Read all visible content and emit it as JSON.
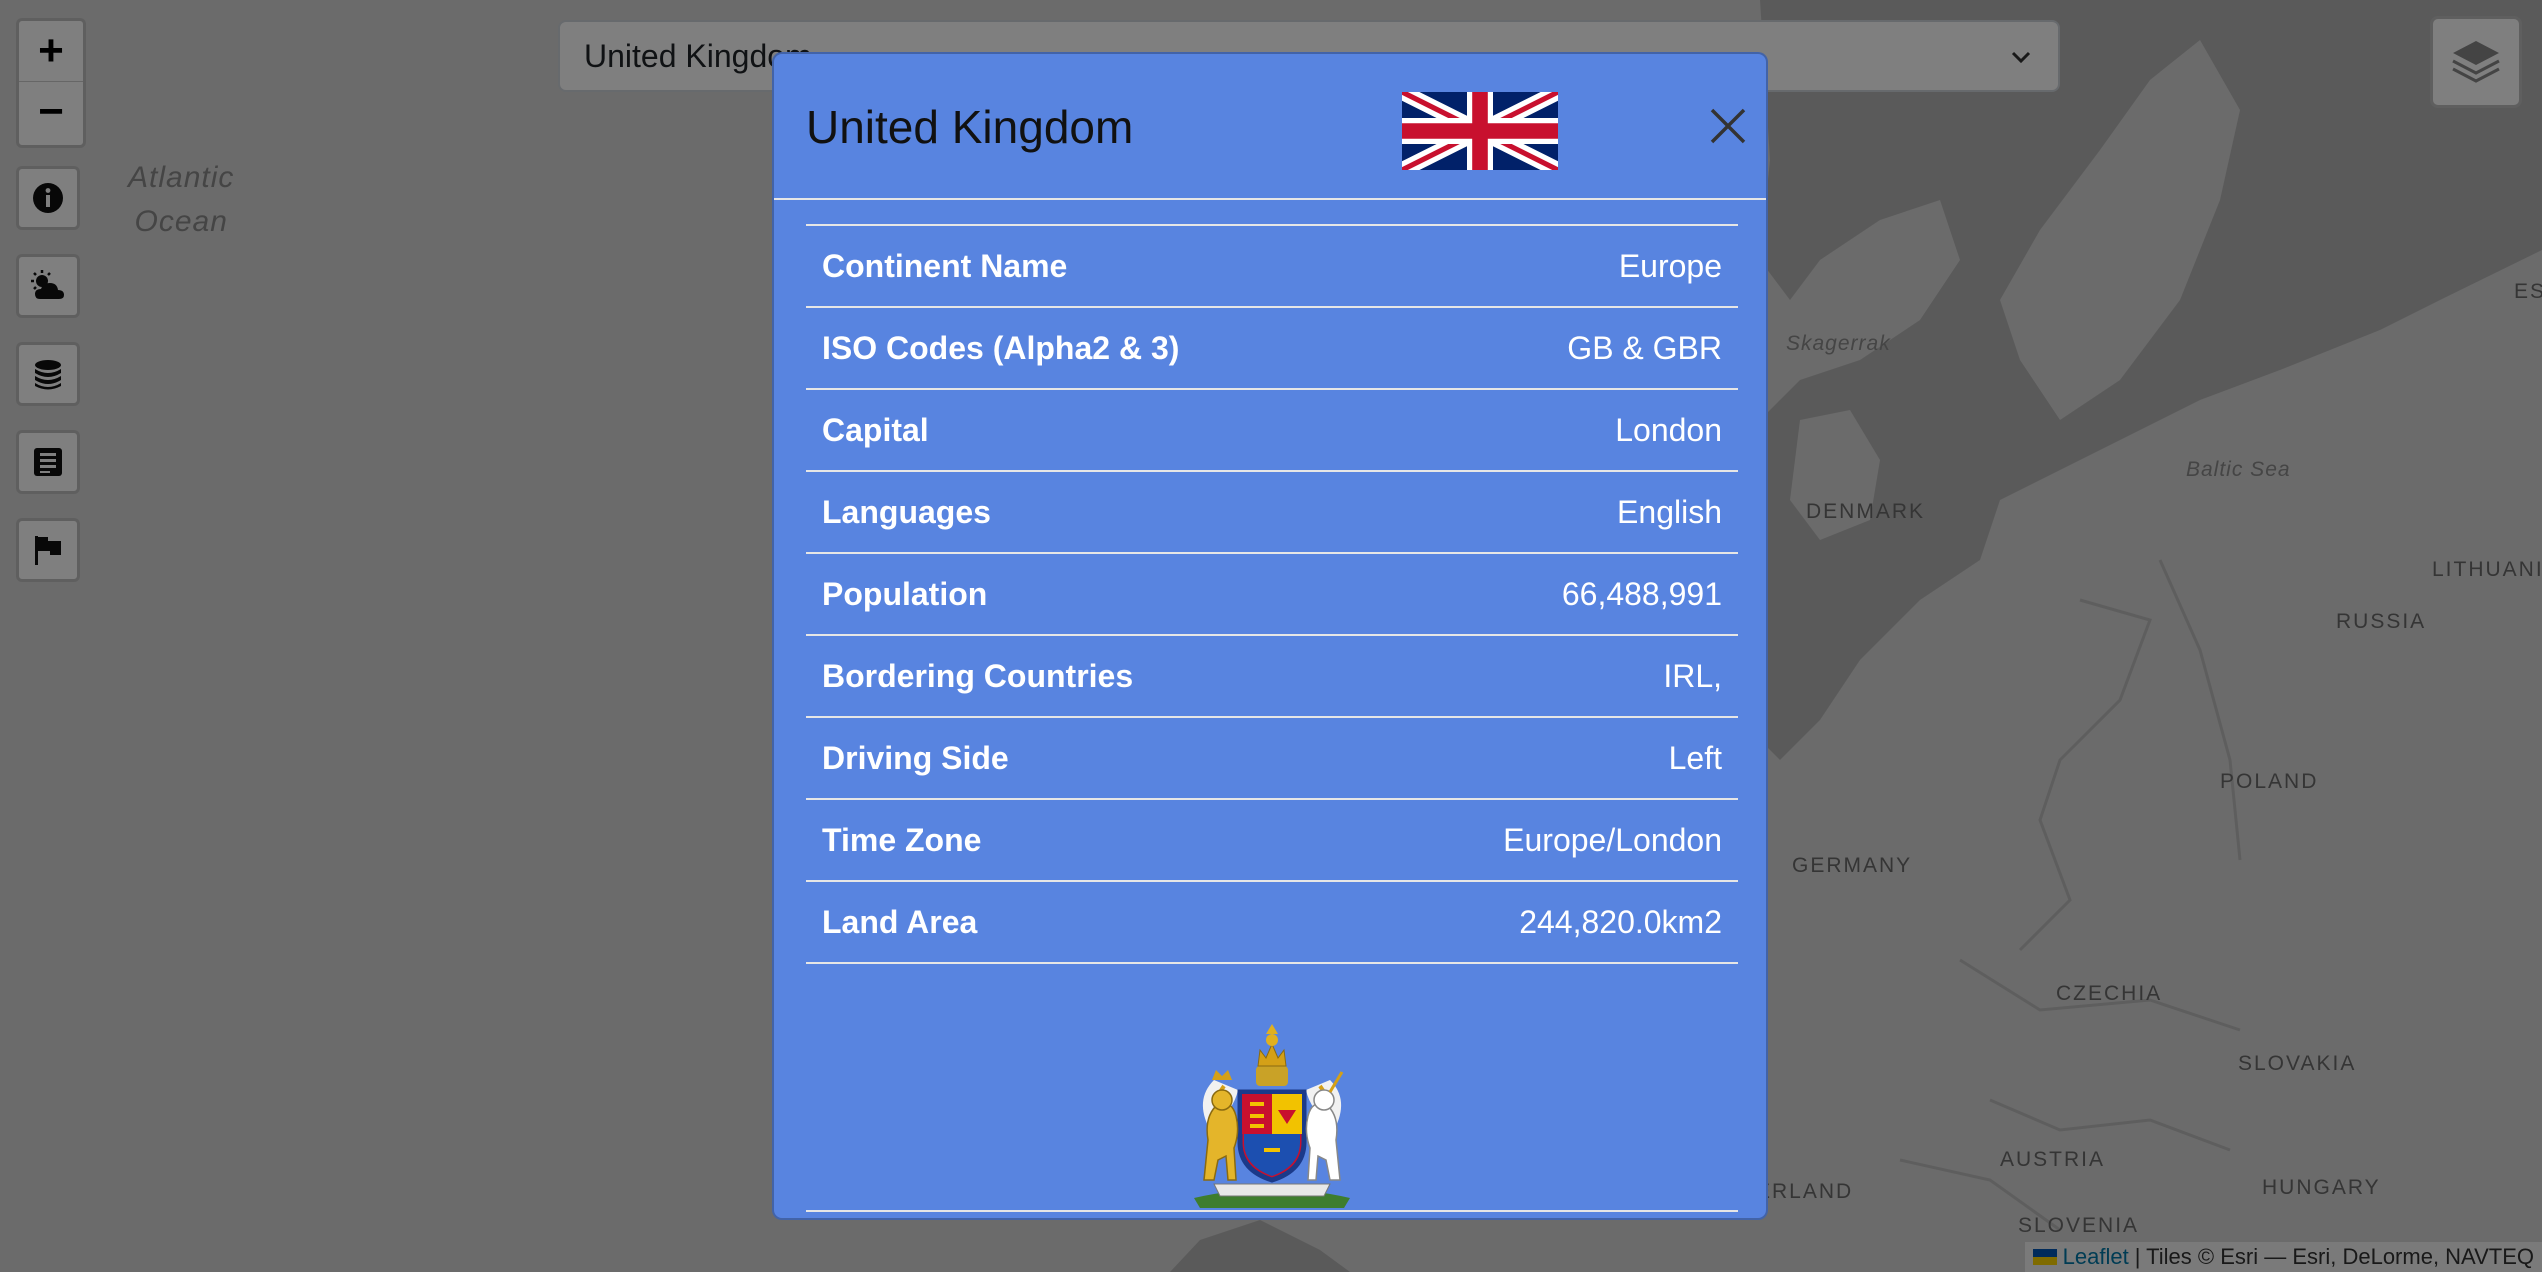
{
  "map": {
    "labels": {
      "ocean": "Atlantic Ocean",
      "skagerrak": "Skagerrak",
      "baltic_sea": "Baltic Sea",
      "denmark": "DENMARK",
      "lithuania": "LITHUANI",
      "russia": "RUSSIA",
      "poland": "POLAND",
      "germany": "GERMANY",
      "czechia": "CZECHIA",
      "slovakia": "SLOVAKIA",
      "austria": "AUSTRIA",
      "hungary": "HUNGARY",
      "slovenia": "SLOVENIA",
      "switzerland_partial": "ERLAND",
      "estonia_partial": "ES"
    },
    "attribution": {
      "leaflet": "Leaflet",
      "tiles": "| Tiles © Esri — Esri, DeLorme, NAVTEQ"
    }
  },
  "controls": {
    "zoom_in": "+",
    "zoom_out": "−",
    "tools": [
      "info-icon",
      "weather-icon",
      "coins-icon",
      "news-icon",
      "flag-icon"
    ],
    "layers_icon": "layers-icon"
  },
  "country_select": {
    "value": "United Kingdom"
  },
  "modal": {
    "title": "United Kingdom",
    "rows": [
      {
        "label": "Continent Name",
        "value": "Europe"
      },
      {
        "label": "ISO Codes (Alpha2 & 3)",
        "value": "GB & GBR"
      },
      {
        "label": "Capital",
        "value": "London"
      },
      {
        "label": "Languages",
        "value": "English"
      },
      {
        "label": "Population",
        "value": "66,488,991"
      },
      {
        "label": "Bordering Countries",
        "value": "IRL,"
      },
      {
        "label": "Driving Side",
        "value": "Left"
      },
      {
        "label": "Time Zone",
        "value": "Europe/London"
      },
      {
        "label": "Land Area",
        "value": "244,820.0km2"
      }
    ]
  },
  "colors": {
    "modal_bg": "#5884e0",
    "backdrop": "rgba(0,0,0,0.5)",
    "map_land": "#d6d6d6",
    "map_water": "#b5b5b5"
  }
}
